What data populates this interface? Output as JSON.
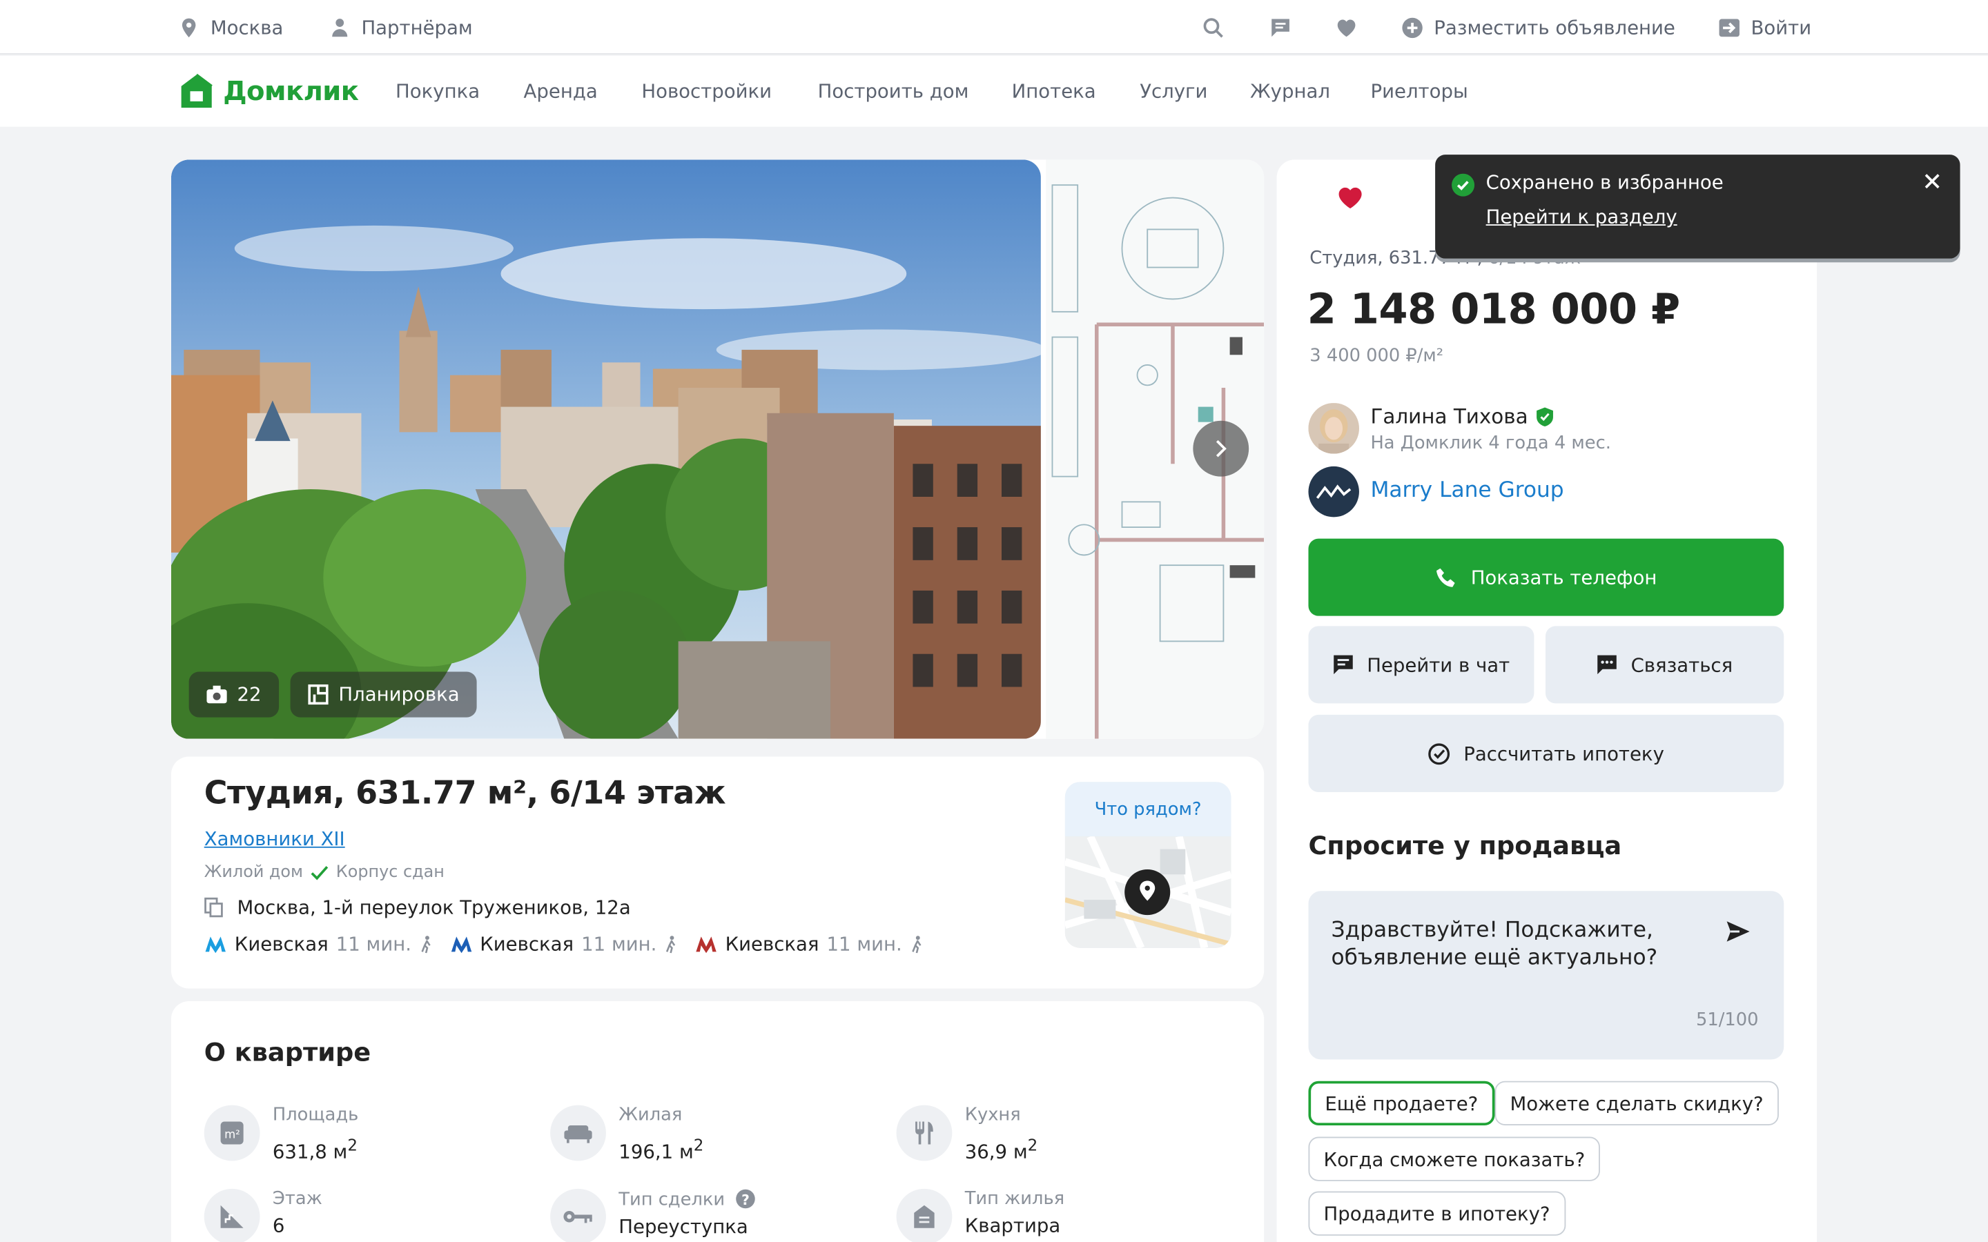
{
  "topbar": {
    "city": "Москва",
    "partners": "Партнёрам",
    "post_ad": "Разместить объявление",
    "login": "Войти"
  },
  "nav": {
    "logo": "Домклик",
    "items": [
      "Покупка",
      "Аренда",
      "Новостройки",
      "Построить дом",
      "Ипотека",
      "Услуги",
      "Журнал",
      "Риелторы"
    ]
  },
  "gallery": {
    "photos_count": "22",
    "plan_label": "Планировка"
  },
  "listing": {
    "title": "Студия, 631.77 м², 6/14 этаж",
    "complex": "Хамовники XII",
    "house_type": "Жилой дом",
    "house_status": "Корпус сдан",
    "address": "Москва, 1-й переулок Тружеников, 12а",
    "metro": [
      {
        "name": "Киевская",
        "time": "11 мин.",
        "color": "#1a9ee0"
      },
      {
        "name": "Киевская",
        "time": "11 мин.",
        "color": "#1d5fb6"
      },
      {
        "name": "Киевская",
        "time": "11 мин.",
        "color": "#b6312e"
      }
    ],
    "nearby_label": "Что рядом?"
  },
  "about": {
    "title": "О квартире",
    "features": [
      {
        "label": "Площадь",
        "value": "631,8 м",
        "sup": "2"
      },
      {
        "label": "Жилая",
        "value": "196,1 м",
        "sup": "2"
      },
      {
        "label": "Кухня",
        "value": "36,9 м",
        "sup": "2"
      },
      {
        "label": "Этаж",
        "value": "6",
        "sup": ""
      },
      {
        "label": "Тип сделки",
        "value": "Переуступка",
        "sup": ""
      },
      {
        "label": "Тип жилья",
        "value": "Квартира",
        "sup": ""
      }
    ]
  },
  "sidebar": {
    "subtitle_main": "Студия, 631.77 м²,",
    "subtitle_floor": "6/14 этаж",
    "price": "2 148 018 000 ₽",
    "price_per_m": "3 400 000 ₽/м²",
    "agent_name": "Галина Тихова",
    "agent_since": "На Домклик 4 года 4 мес.",
    "agency": "Marry Lane Group",
    "show_phone": "Показать телефон",
    "go_chat": "Перейти в чат",
    "contact": "Связаться",
    "mortgage": "Рассчитать ипотеку",
    "ask_title": "Спросите у продавца",
    "message": "Здравствуйте! Подскажите, объявление ещё актуально?",
    "counter": "51/100",
    "chips": [
      "Ещё продаете?",
      "Можете сделать скидку?",
      "Когда сможете показать?",
      "Продадите в ипотеку?"
    ]
  },
  "toast": {
    "text": "Сохранено в избранное",
    "link": "Перейти к разделу"
  },
  "colors": {
    "brand": "#21a038",
    "link": "#1a7ccb",
    "favorite": "#d11a3c"
  }
}
